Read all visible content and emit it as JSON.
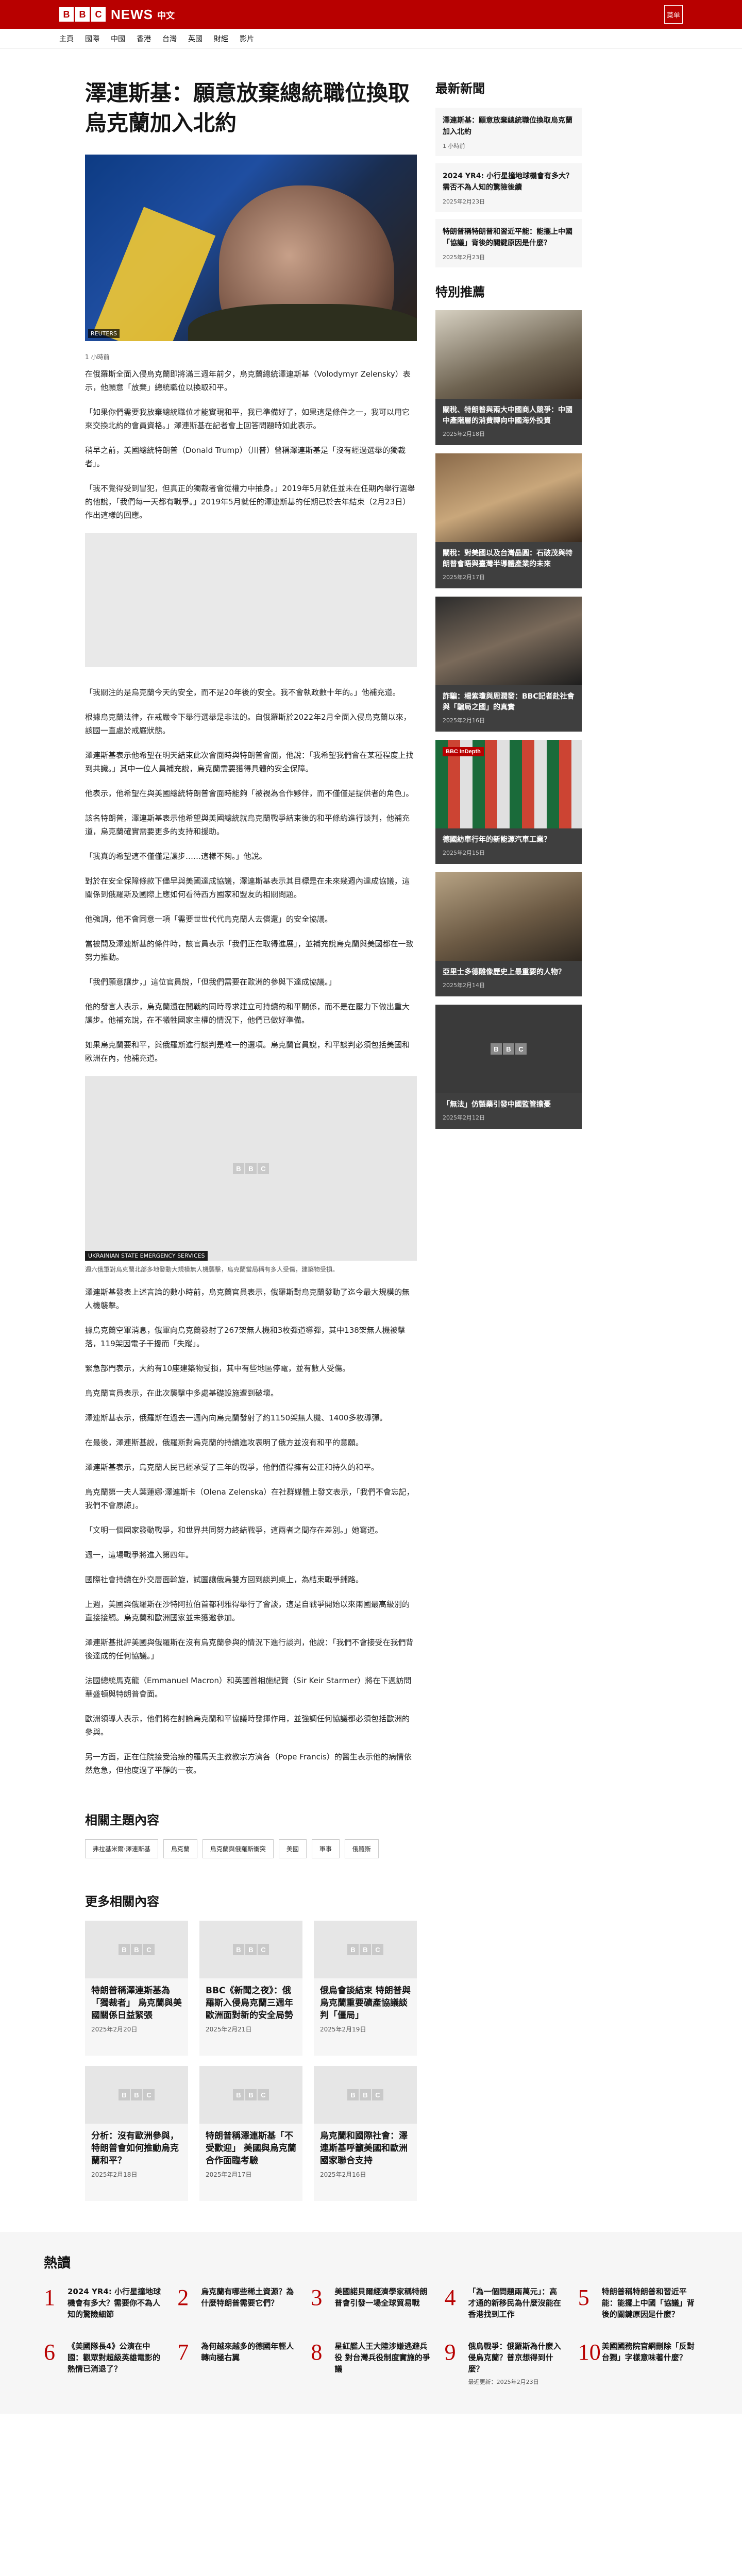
{
  "header": {
    "logo_letters": [
      "B",
      "B",
      "C"
    ],
    "brand": "NEWS",
    "brand_sub": "中文",
    "menu_label": "菜单"
  },
  "nav": [
    "主頁",
    "國際",
    "中國",
    "香港",
    "台灣",
    "英國",
    "財經",
    "影片"
  ],
  "article": {
    "title": "澤連斯基：願意放棄總統職位換取烏克蘭加入北約",
    "hero_credit": "REUTERS",
    "meta": "1 小時前",
    "paragraphs_a": [
      "在俄羅斯全面入侵烏克蘭即將滿三週年前夕，烏克蘭總統澤連斯基（Volodymyr Zelensky）表示，他願意「放棄」總統職位以換取和平。",
      "「如果你們需要我放棄總統職位才能實現和平，我已準備好了，如果這是條件之一，我可以用它來交換北約的會員資格。」澤連斯基在記者會上回答問題時如此表示。",
      "稍早之前，美國總統特朗普（Donald Trump）（川普）曾稱澤連斯基是「沒有經過選舉的獨裁者」。",
      "「我不覺得受到冒犯，但真正的獨裁者會從權力中抽身。」2019年5月就任並未在任期內舉行選舉的他說，「我們每一天都有戰爭。」2019年5月就任的澤連斯基的任期已於去年結束（2月23日）作出這樣的回應。"
    ],
    "paragraphs_b": [
      "「我關注的是烏克蘭今天的安全，而不是20年後的安全。我不會執政數十年的。」他補充道。",
      "根據烏克蘭法律，在戒嚴令下舉行選舉是非法的。自俄羅斯於2022年2月全面入侵烏克蘭以來，該國一直處於戒嚴狀態。",
      "澤連斯基表示他希望在明天結束此次會面時與特朗普會面，他說：「我希望我們會在某種程度上找到共識。」其中一位人員補充說，烏克蘭需要獲得具體的安全保障。",
      "他表示，他希望在與美國總統特朗普會面時能夠「被視為合作夥伴，而不僅僅是提供者的角色」。",
      "該名特朗普，澤連斯基表示他希望與美國總統就烏克蘭戰爭結束後的和平條約進行談判，他補充道，烏克蘭確實需要更多的支持和援助。",
      "「我真的希望這不僅僅是讓步……這樣不夠。」他說。",
      "對於在安全保障條款下儘早與美國達成協議，澤連斯基表示其目標是在未來幾週內達成協議，這關係到俄羅斯及國際上應如何看待西方國家和盟友的相關問題。",
      "他強調，他不會同意一項「需要世世代代烏克蘭人去償還」的安全協議。",
      "當被問及澤連斯基的條件時，該官員表示「我們正在取得進展」，並補充說烏克蘭與美國都在一致努力推動。",
      "「我們願意讓步，」這位官員說，「但我們需要在歐洲的參與下達成協議。」",
      "他的發言人表示，烏克蘭還在開戰的同時尋求建立可持續的和平關係，而不是在壓力下做出重大讓步。他補充說，在不犧牲國家主權的情況下，他們已做好準備。",
      "如果烏克蘭要和平，與俄羅斯進行談判是唯一的選項。烏克蘭官員說，和平談判必須包括美國和歐洲在內，他補充道。"
    ],
    "fig2_credit": "UKRAINIAN STATE EMERGENCY SERVICES",
    "fig2_caption": "週六俄軍對烏克蘭北部多地發動大規模無人機襲擊，烏克蘭當局稱有多人受傷，建築物受損。",
    "paragraphs_c": [
      "澤連斯基發表上述言論的數小時前，烏克蘭官員表示，俄羅斯對烏克蘭發動了迄今最大規模的無人機襲擊。",
      "據烏克蘭空軍消息，俄軍向烏克蘭發射了267架無人機和3枚彈道導彈，其中138架無人機被擊落，119架因電子干擾而「失蹤」。",
      "緊急部門表示，大約有10座建築物受損，其中有些地區停電，並有數人受傷。",
      "烏克蘭官員表示，在此次襲擊中多處基礎設施遭到破壞。",
      "澤連斯基表示，俄羅斯在過去一週內向烏克蘭發射了約1150架無人機、1400多枚導彈。",
      "在最後，澤連斯基說，俄羅斯對烏克蘭的持續進攻表明了俄方並沒有和平的意願。",
      "澤連斯基表示，烏克蘭人民已經承受了三年的戰爭，他們值得擁有公正和持久的和平。",
      "烏克蘭第一夫人葉蓮娜·澤連斯卡（Olena Zelenska）在社群媒體上發文表示，「我們不會忘記，我們不會原諒」。",
      "「文明一個國家發動戰爭，和世界共同努力終結戰爭，這兩者之間存在差別。」她寫道。",
      "週一，這場戰爭將進入第四年。",
      "國際社會持續在外交層面斡旋，試圖讓俄烏雙方回到談判桌上，為結束戰爭鋪路。",
      "上週，美國與俄羅斯在沙特阿拉伯首都利雅得舉行了會談，這是自戰爭開始以來兩國最高級別的直接接觸。烏克蘭和歐洲國家並未獲邀參加。",
      "澤連斯基批評美國與俄羅斯在沒有烏克蘭參與的情況下進行談判，他說：「我們不會接受在我們背後達成的任何協議。」",
      "法國總統馬克龍（Emmanuel Macron）和英國首相施紀賢（Sir Keir Starmer）將在下週訪問華盛頓與特朗普會面。",
      "歐洲領導人表示，他們將在討論烏克蘭和平協議時發揮作用，並強調任何協議都必須包括歐洲的參與。",
      "另一方面，正在住院接受治療的羅馬天主教教宗方濟各（Pope Francis）的醫生表示他的病情依然危急，但他度過了平靜的一夜。"
    ]
  },
  "related_topics": {
    "title": "相關主題內容",
    "tags": [
      "弗拉基米爾·澤連斯基",
      "烏克蘭",
      "烏克蘭與俄羅斯衝突",
      "美國",
      "軍事",
      "俄羅斯"
    ]
  },
  "more": {
    "title": "更多相關內容",
    "cards": [
      {
        "title": "特朗普稱澤連斯基為「獨裁者」 烏克蘭與美國關係日益緊張",
        "date": "2025年2月20日"
      },
      {
        "title": "BBC《新聞之夜》：俄羅斯入侵烏克蘭三週年 歐洲面對新的安全局勢",
        "date": "2025年2月21日"
      },
      {
        "title": "俄烏會談結束 特朗普與烏克蘭重要礦產協議談判「僵局」",
        "date": "2025年2月19日"
      },
      {
        "title": "分析：沒有歐洲參與，特朗普會如何推動烏克蘭和平？",
        "date": "2025年2月18日"
      },
      {
        "title": "特朗普稱澤連斯基「不受歡迎」 美國與烏克蘭合作面臨考驗",
        "date": "2025年2月17日"
      },
      {
        "title": "烏克蘭和國際社會：澤連斯基呼籲美國和歐洲國家聯合支持",
        "date": "2025年2月16日"
      }
    ]
  },
  "sidebar": {
    "latest_title": "最新新聞",
    "latest": [
      {
        "title": "澤連斯基：願意放棄總統職位換取烏克蘭加入北約",
        "date": "1 小時前"
      },
      {
        "title": "2024 YR4: 小行星撞地球機會有多大？需否不為人知的驚險後續",
        "date": "2025年2月23日"
      },
      {
        "title": "特朗普稱特朗普和習近平能：能擺上中國「協議」背後的關鍵原因是什麼？",
        "date": "2025年2月23日"
      }
    ],
    "features_title": "特別推薦",
    "features": [
      {
        "title": "關稅、特朗普與兩大中國商人競爭：中國中產階層的消費轉向中國海外投資",
        "date": "2025年2月18日",
        "badge": ""
      },
      {
        "title": "關稅：對美國以及台灣晶圓：石破茂與特朗普會晤與臺灣半導體產業的未來",
        "date": "2025年2月17日",
        "badge": ""
      },
      {
        "title": "詐騙：楊紫瓊與周潤發：BBC記者赴社會與「騙局之國」的真實",
        "date": "2025年2月16日",
        "badge": ""
      },
      {
        "title": "德國紡車行年的新能源汽車工業？",
        "date": "2025年2月15日",
        "badge": "BBC InDepth"
      },
      {
        "title": "亞里士多德雕像歷史上最重要的人物？",
        "date": "2025年2月14日",
        "badge": ""
      },
      {
        "title": "「無法」仿製藥引發中國監管擔憂",
        "date": "2025年2月12日",
        "badge": ""
      }
    ]
  },
  "popular": {
    "title": "熱讀",
    "items": [
      {
        "n": "1",
        "title": "2024 YR4: 小行星撞地球機會有多大？需要你不為人知的驚險細節",
        "date": ""
      },
      {
        "n": "2",
        "title": "烏克蘭有哪些稀土資源？為什麼特朗普需要它們？",
        "date": ""
      },
      {
        "n": "3",
        "title": "美國諾貝爾經濟學家稱特朗普會引發一場全球貿易戰",
        "date": ""
      },
      {
        "n": "4",
        "title": "「為一個問題兩萬元」：高才通的新移民為什麼沒能在香港找到工作",
        "date": ""
      },
      {
        "n": "5",
        "title": "特朗普稱特朗普和習近平能：能擺上中國「協議」背後的關鍵原因是什麼？",
        "date": ""
      },
      {
        "n": "6",
        "title": "《美國隊長4》公演在中國：觀眾對超級英雄電影的熱情已消退了？",
        "date": ""
      },
      {
        "n": "7",
        "title": "為何越來越多的德國年輕人轉向極右翼",
        "date": ""
      },
      {
        "n": "8",
        "title": "星紅艦人王大陸涉嫌逃避兵役 對台灣兵役制度實施的爭議",
        "date": ""
      },
      {
        "n": "9",
        "title": "俄烏戰爭：俄羅斯為什麼入侵烏克蘭？普京想得到什麼？",
        "date": "最近更新：2025年2月23日"
      },
      {
        "n": "10",
        "title": "美國國務院官網刪除「反對台獨」字樣意味著什麼？",
        "date": ""
      }
    ]
  },
  "colors": {
    "brand_red": "#b80000",
    "card_bg": "#f6f6f6",
    "feature_bg": "#3f3f3f"
  }
}
